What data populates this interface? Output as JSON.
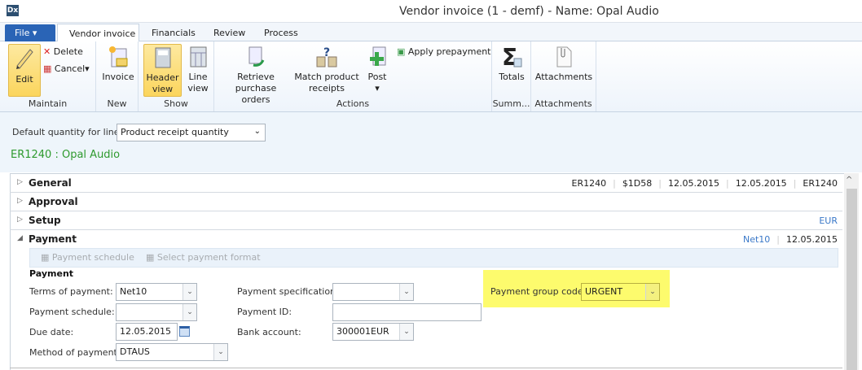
{
  "window": {
    "title": "Vendor invoice (1 - demf) - Name: Opal Audio",
    "app_icon": "Dx"
  },
  "tabs": {
    "file": "File",
    "items": [
      "Vendor invoice",
      "Financials",
      "Review",
      "Process"
    ]
  },
  "ribbon": {
    "maintain": {
      "label": "Maintain",
      "edit": "Edit",
      "delete": "Delete",
      "cancel": "Cancel"
    },
    "new": {
      "label": "New",
      "invoice": "Invoice"
    },
    "show": {
      "label": "Show",
      "header_view": [
        "Header",
        "view"
      ],
      "line_view": [
        "Line",
        "view"
      ]
    },
    "actions": {
      "label": "Actions",
      "retrieve": [
        "Retrieve",
        "purchase orders"
      ],
      "match": [
        "Match product",
        "receipts"
      ],
      "post": "Post",
      "apply_prepayment": "Apply prepayment"
    },
    "summary": {
      "label": "Summ...",
      "totals": "Totals"
    },
    "attachments": {
      "label": "Attachments",
      "attachments": "Attachments"
    }
  },
  "options": {
    "default_qty_label": "Default quantity for lines:",
    "default_qty_value": "Product receipt quantity",
    "record_title": "ER1240 : Opal Audio"
  },
  "sections": {
    "general": {
      "name": "General",
      "summary": [
        "ER1240",
        "$1D58",
        "12.05.2015",
        "12.05.2015",
        "ER1240"
      ]
    },
    "approval": {
      "name": "Approval"
    },
    "setup": {
      "name": "Setup",
      "summary": "EUR"
    },
    "payment": {
      "name": "Payment",
      "summary_terms": "Net10",
      "summary_date": "12.05.2015"
    }
  },
  "payment": {
    "toolbar": {
      "schedule": "Payment schedule",
      "format": "Select payment format"
    },
    "group_title": "Payment",
    "terms_label": "Terms of payment:",
    "terms_value": "Net10",
    "schedule_label": "Payment schedule:",
    "schedule_value": "",
    "due_label": "Due date:",
    "due_value": "12.05.2015",
    "method_label": "Method of payment:",
    "method_value": "DTAUS",
    "spec_label": "Payment specification:",
    "spec_value": "",
    "id_label": "Payment ID:",
    "id_value": "",
    "bank_label": "Bank account:",
    "bank_value": "300001EUR",
    "group_code_label": "Payment group code:",
    "group_code_value": "URGENT"
  },
  "colors": {
    "highlight": "#fdfb6d",
    "record_title": "#2e9a2e",
    "link": "#3a78c8",
    "file_tab": "#2a64b6"
  }
}
